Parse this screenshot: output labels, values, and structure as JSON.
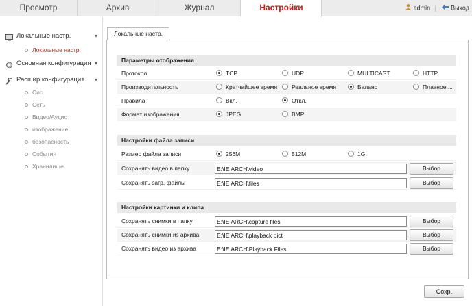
{
  "topnav": {
    "tabs": [
      {
        "label": "Просмотр"
      },
      {
        "label": "Архив"
      },
      {
        "label": "Журнал"
      },
      {
        "label": "Настройки",
        "active": true
      }
    ],
    "user": "admin",
    "logout": "Выход"
  },
  "sidebar": {
    "local": "Локальные настр.",
    "local_item": "Локальные настр.",
    "basic": "Основная конфигурация",
    "advanced": "Расшир конфигурация",
    "items": [
      "Сис.",
      "Сеть",
      "Видео/Аудио",
      "изображение",
      "безопасность",
      "События",
      "Хранилище"
    ]
  },
  "subtab": "Локальные настр.",
  "display": {
    "title": "Параметры отображения",
    "protocol": {
      "label": "Протокол",
      "options": [
        "TCP",
        "UDP",
        "MULTICAST",
        "HTTP"
      ],
      "selected": "TCP"
    },
    "performance": {
      "label": "Производительность",
      "options": [
        "Кратчайшее время",
        "Реальное время",
        "Баланс",
        "Плавное ..."
      ],
      "selected": "Баланс"
    },
    "rules": {
      "label": "Правила",
      "options": [
        "Вкл.",
        "Откл."
      ],
      "selected": "Откл."
    },
    "format": {
      "label": "Формат изображения",
      "options": [
        "JPEG",
        "BMP"
      ],
      "selected": "JPEG"
    }
  },
  "record": {
    "title": "Настройки файла записи",
    "size": {
      "label": "Размер файла записи",
      "options": [
        "256M",
        "512M",
        "1G"
      ],
      "selected": "256M"
    },
    "video_folder": {
      "label": "Сохранять видео в папку",
      "value": "E:\\IE ARCH\\video",
      "button": "Выбор"
    },
    "downloads": {
      "label": "Сохранять загр. файлы",
      "value": "E:\\IE ARCH\\files",
      "button": "Выбор"
    }
  },
  "clip": {
    "title": "Настройки картинки и клипа",
    "snapshots": {
      "label": "Сохранять снимки в папку",
      "value": "E:\\IE ARCH\\capture files",
      "button": "Выбор"
    },
    "snapshots_archive": {
      "label": "Сохранять снимки из архива",
      "value": "E:\\IE ARCH\\playback pict",
      "button": "Выбор"
    },
    "video_archive": {
      "label": "Сохранять видео из архива",
      "value": "E:\\IE ARCH\\Playback Files",
      "button": "Выбор"
    }
  },
  "save": "Сохр."
}
